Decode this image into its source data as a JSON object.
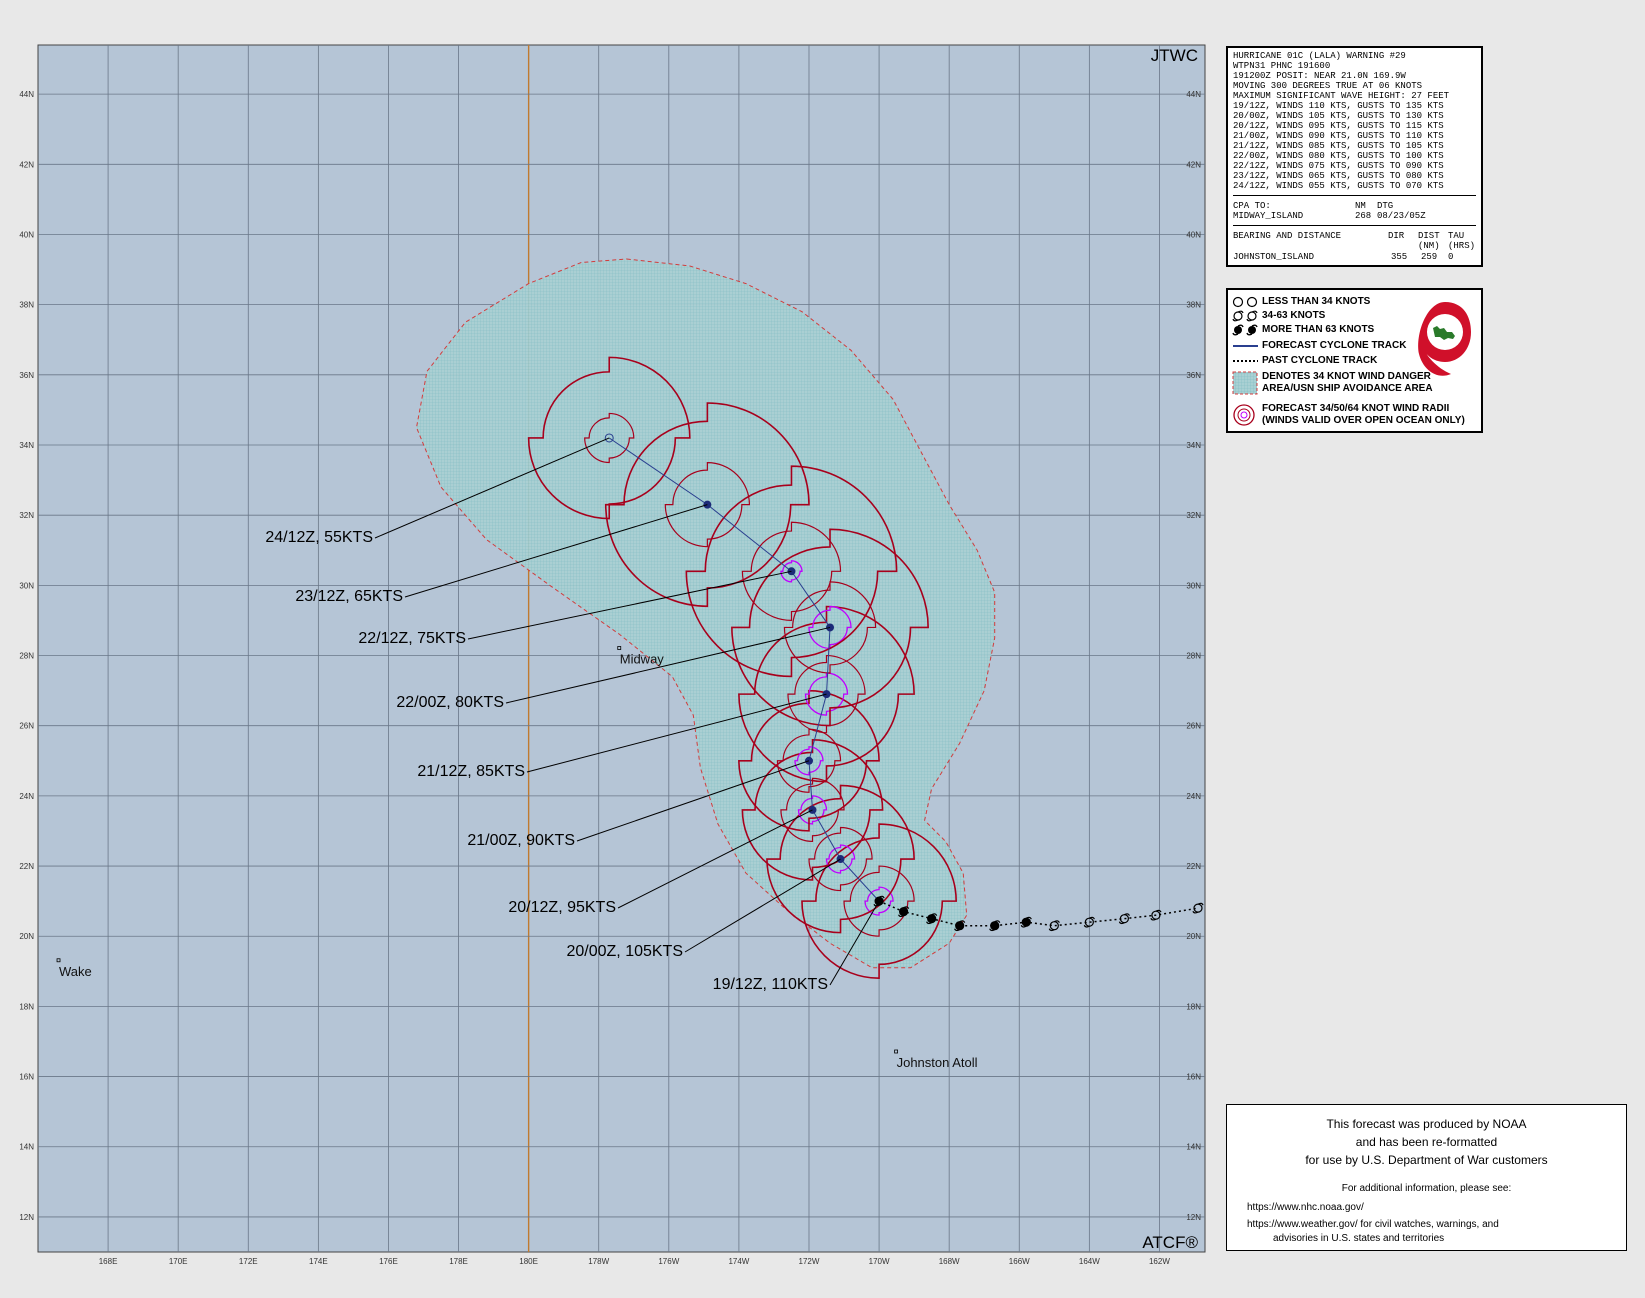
{
  "map": {
    "lon_range": [
      166,
      199.3
    ],
    "lat_range": [
      11.0,
      45.4
    ],
    "lat_ticks": [
      "12N",
      "14N",
      "16N",
      "18N",
      "20N",
      "22N",
      "24N",
      "26N",
      "28N",
      "30N",
      "32N",
      "34N",
      "36N",
      "38N",
      "40N",
      "42N",
      "44N"
    ],
    "lon_ticks": [
      "168E",
      "170E",
      "172E",
      "174E",
      "176E",
      "178E",
      "180E",
      "178W",
      "176W",
      "174W",
      "172W",
      "170W",
      "168W",
      "166W",
      "164W",
      "162W"
    ],
    "corner_top": "JTWC",
    "corner_bottom": "ATCF®",
    "colors": {
      "ocean": "#b5c5d6",
      "danger_fill": "#a9d0d3",
      "danger_edge": "#d23c3c",
      "radii_34": "#a8001c",
      "radii_64": "#c000ff",
      "track": "#2a3f8f",
      "dateline": "#c07a30"
    }
  },
  "places": [
    {
      "name": "Midway",
      "lon": 182.6,
      "lat": 28.2
    },
    {
      "name": "Wake",
      "lon": 166.6,
      "lat": 19.3
    },
    {
      "name": "Johnston Atoll",
      "lon": 190.5,
      "lat": 16.7
    }
  ],
  "forecast_track": [
    {
      "time": "19/12Z",
      "lon": 190.0,
      "lat": 21.0,
      "label": "19/12Z, 110KTS",
      "intensity": "hurricane"
    },
    {
      "time": "20/00Z",
      "lon": 188.9,
      "lat": 22.2,
      "label": "20/00Z, 105KTS",
      "intensity": "hurricane"
    },
    {
      "time": "20/12Z",
      "lon": 188.1,
      "lat": 23.6,
      "label": "20/12Z,  95KTS",
      "intensity": "hurricane"
    },
    {
      "time": "21/00Z",
      "lon": 188.0,
      "lat": 25.0,
      "label": "21/00Z,  90KTS",
      "intensity": "hurricane"
    },
    {
      "time": "21/12Z",
      "lon": 188.5,
      "lat": 26.9,
      "label": "21/12Z,  85KTS",
      "intensity": "hurricane"
    },
    {
      "time": "22/00Z",
      "lon": 188.6,
      "lat": 28.8,
      "label": "22/00Z,  80KTS",
      "intensity": "hurricane"
    },
    {
      "time": "22/12Z",
      "lon": 187.5,
      "lat": 30.4,
      "label": "22/12Z,  75KTS",
      "intensity": "hurricane"
    },
    {
      "time": "23/12Z",
      "lon": 185.1,
      "lat": 32.3,
      "label": "23/12Z,  65KTS",
      "intensity": "hurricane"
    },
    {
      "time": "24/12Z",
      "lon": 182.3,
      "lat": 34.2,
      "label": "24/12Z,  55KTS",
      "intensity": "storm"
    }
  ],
  "past_track": [
    {
      "lon": 190.7,
      "lat": 20.7,
      "intensity": "hurricane"
    },
    {
      "lon": 191.5,
      "lat": 20.5,
      "intensity": "hurricane"
    },
    {
      "lon": 192.3,
      "lat": 20.3,
      "intensity": "hurricane"
    },
    {
      "lon": 193.3,
      "lat": 20.3,
      "intensity": "hurricane"
    },
    {
      "lon": 194.2,
      "lat": 20.4,
      "intensity": "hurricane"
    },
    {
      "lon": 195.0,
      "lat": 20.3,
      "intensity": "storm"
    },
    {
      "lon": 196.0,
      "lat": 20.4,
      "intensity": "storm"
    },
    {
      "lon": 197.0,
      "lat": 20.5,
      "intensity": "storm"
    },
    {
      "lon": 197.9,
      "lat": 20.6,
      "intensity": "storm"
    },
    {
      "lon": 199.1,
      "lat": 20.8,
      "intensity": "storm"
    }
  ],
  "warning": {
    "lines": [
      "HURRICANE 01C (LALA) WARNING #29",
      "WTPN31 PHNC 191600",
      "191200Z POSIT: NEAR 21.0N 169.9W",
      "MOVING 300 DEGREES TRUE AT 06 KNOTS",
      "MAXIMUM SIGNIFICANT WAVE HEIGHT: 27 FEET",
      "19/12Z, WINDS 110 KTS, GUSTS TO 135 KTS",
      "20/00Z, WINDS 105 KTS, GUSTS TO 130 KTS",
      "20/12Z, WINDS 095 KTS, GUSTS TO 115 KTS",
      "21/00Z, WINDS 090 KTS, GUSTS TO 110 KTS",
      "21/12Z, WINDS 085 KTS, GUSTS TO 105 KTS",
      "22/00Z, WINDS 080 KTS, GUSTS TO 100 KTS",
      "22/12Z, WINDS 075 KTS, GUSTS TO 090 KTS",
      "23/12Z, WINDS 065 KTS, GUSTS TO 080 KTS",
      "24/12Z, WINDS 055 KTS, GUSTS TO 070 KTS"
    ],
    "cpa_header": [
      "CPA TO:",
      "NM",
      "DTG"
    ],
    "cpa_row": [
      "MIDWAY_ISLAND",
      "268",
      "08/23/05Z"
    ],
    "bd_header": [
      "BEARING AND DISTANCE",
      "DIR",
      "DIST",
      "TAU"
    ],
    "bd_sub": [
      "",
      "",
      "(NM)",
      "(HRS)"
    ],
    "bd_row": [
      "JOHNSTON_ISLAND",
      "355",
      "259",
      "0"
    ]
  },
  "legend": {
    "items": [
      "LESS THAN 34 KNOTS",
      "34-63 KNOTS",
      "MORE THAN 63 KNOTS",
      "FORECAST CYCLONE TRACK",
      "PAST CYCLONE TRACK",
      "DENOTES 34 KNOT WIND DANGER",
      "AREA/USN SHIP AVOIDANCE AREA",
      "FORECAST 34/50/64 KNOT WIND RADII",
      "(WINDS VALID OVER OPEN OCEAN ONLY)"
    ]
  },
  "noaa": {
    "line1": "This forecast was produced by NOAA",
    "line2": "and has been re-formatted",
    "line3": "for use by U.S. Department of War customers",
    "additional": "For additional information, please see:",
    "link1": "https://www.nhc.noaa.gov/",
    "link2": "https://www.weather.gov/ for civil watches, warnings, and",
    "link3": "advisories in U.S. states and territories"
  }
}
